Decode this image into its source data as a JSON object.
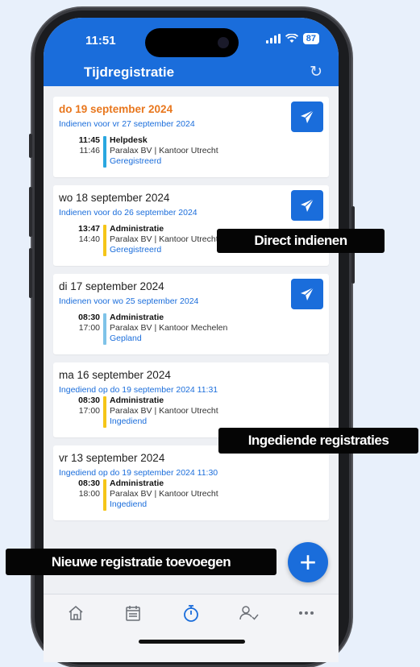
{
  "status_bar": {
    "time": "11:51",
    "battery": "87"
  },
  "header": {
    "title": "Tijdregistratie"
  },
  "days": [
    {
      "date": "do 19 september 2024",
      "sub": "Indienen voor vr 27 september 2024",
      "entry": {
        "start": "11:45",
        "end": "11:46",
        "title": "Helpdesk",
        "client": "Paralax BV | Kantoor Utrecht",
        "status": "Geregistreerd"
      }
    },
    {
      "date": "wo 18 september 2024",
      "sub": "Indienen voor do 26 september 2024",
      "entry": {
        "start": "13:47",
        "end": "14:40",
        "title": "Administratie",
        "client": "Paralax BV | Kantoor Utrecht",
        "status": "Geregistreerd"
      }
    },
    {
      "date": "di 17 september 2024",
      "sub": "Indienen voor wo 25 september 2024",
      "entry": {
        "start": "08:30",
        "end": "17:00",
        "title": "Administratie",
        "client": "Paralax BV | Kantoor Mechelen",
        "status": "Gepland"
      }
    },
    {
      "date": "ma 16 september 2024",
      "sub": "Ingediend op do 19 september 2024 11:31",
      "entry": {
        "start": "08:30",
        "end": "17:00",
        "title": "Administratie",
        "client": "Paralax BV | Kantoor Utrecht",
        "status": "Ingediend"
      }
    },
    {
      "date": "vr 13 september 2024",
      "sub": "Ingediend op do 19 september 2024 11:30",
      "entry": {
        "start": "08:30",
        "end": "18:00",
        "title": "Administratie",
        "client": "Paralax BV | Kantoor Utrecht",
        "status": "Ingediend"
      }
    }
  ],
  "fab": {
    "label": "+"
  },
  "tabbar": [
    "home-icon",
    "calendar-icon",
    "stopwatch-icon",
    "user-check-icon",
    "more-icon"
  ],
  "callouts": {
    "direct": "Direct indienen",
    "submitted": "Ingediende registraties",
    "new": "Nieuwe registratie toevoegen"
  },
  "colors": {
    "primary": "#1a6ddb",
    "today": "#e8771e",
    "bar_helpdesk": "#2aa7e0",
    "bar_admin": "#f5c518",
    "bar_planned": "#7fc3e8"
  }
}
